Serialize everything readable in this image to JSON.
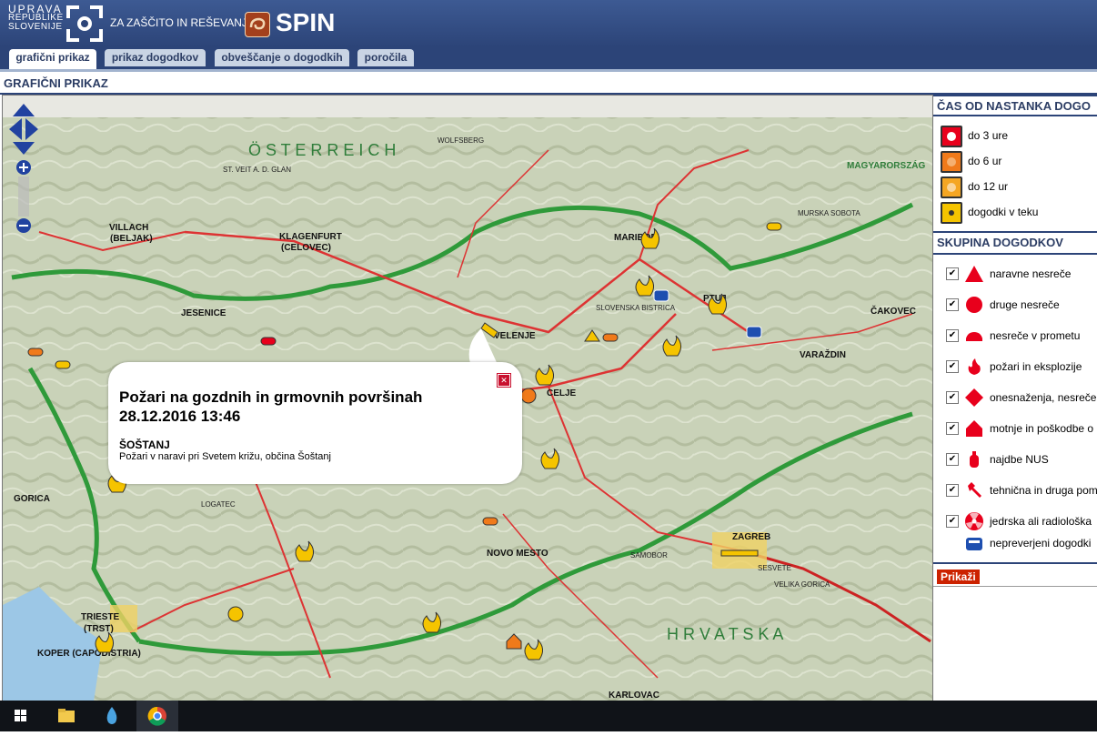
{
  "header": {
    "org_line1": "UPRAVA",
    "org_line2": "REPUBLIKE",
    "org_line3": "SLOVENIJE",
    "org_subtitle": "ZA ZAŠČITO IN REŠEVANJE",
    "app_name": "SPIN"
  },
  "tabs": [
    {
      "label": "grafični prikaz",
      "active": true
    },
    {
      "label": "prikaz dogodkov",
      "active": false
    },
    {
      "label": "obveščanje o dogodkih",
      "active": false
    },
    {
      "label": "poročila",
      "active": false
    }
  ],
  "page_title": "GRAFIČNI PRIKAZ",
  "popup": {
    "title_line1": "Požari na gozdnih in grmovnih površinah",
    "title_line2": "28.12.2016 13:46",
    "location": "ŠOŠTANJ",
    "description": "Požari v naravi pri Svetem križu, občina Šoštanj"
  },
  "sidebar": {
    "time_heading": "ČAS OD NASTANKA DOGO",
    "time_legend": [
      {
        "label": "do 3 ure",
        "color": "#e8001c"
      },
      {
        "label": "do 6 ur",
        "color": "#f07a1a"
      },
      {
        "label": "do 12 ur",
        "color": "#f5a623"
      },
      {
        "label": "dogodki v teku",
        "color": "#f5c400"
      }
    ],
    "group_heading": "SKUPINA DOGODKOV",
    "groups": [
      {
        "label": "naravne nesreče",
        "icon": "triangle-warning-icon",
        "checked": true
      },
      {
        "label": "druge nesreče",
        "icon": "circle-icon",
        "checked": true
      },
      {
        "label": "nesreče v prometu",
        "icon": "car-icon",
        "checked": true
      },
      {
        "label": "požari in eksplozije",
        "icon": "flame-icon",
        "checked": true
      },
      {
        "label": "onesnaženja, nesreče",
        "icon": "diamond-icon",
        "checked": true
      },
      {
        "label": "motnje in poškodbe o",
        "icon": "house-icon",
        "checked": true
      },
      {
        "label": "najdbe NUS",
        "icon": "bomb-icon",
        "checked": true
      },
      {
        "label": "tehnična in druga pom",
        "icon": "wrench-icon",
        "checked": true
      },
      {
        "label": "jedrska ali radiološka",
        "icon": "radiation-icon",
        "checked": true
      },
      {
        "label": "nepreverjeni dogodki",
        "icon": "phone-icon",
        "checked": false
      }
    ],
    "show_button": "Prikaži"
  },
  "map_labels": {
    "klagenfurt": "KLAGENFURT",
    "celovec": "(CELOVEC)",
    "maribor": "MARIBOR",
    "celje": "CELJE",
    "zagreb": "ZAGREB",
    "trieste": "TRIESTE",
    "trst": "(TRST)",
    "velenje": "VELENJE",
    "villach": "VILLACH",
    "beljak": "(BELJAK)",
    "ptuj": "PTUJ",
    "novo_mesto": "NOVO MESTO",
    "koper": "KOPER (CAPODISTRIA)",
    "murska_sobota": "MURSKA SOBOTA",
    "varazdin": "VARAŽDIN",
    "cakovec": "ČAKOVEC",
    "karlovac": "KARLOVAC",
    "samobor": "SAMOBOR",
    "logatec": "LOGATEC",
    "gorica": "GORICA",
    "slovenska_bistrica": "SLOVENSKA BISTRICA",
    "jesenice": "JESENICE",
    "st_veit": "ST. VEIT A. D. GLAN",
    "wolfsberg": "WOLFSBERG",
    "sesvete": "SESVETE",
    "velika_gorica": "VELIKA GORICA",
    "osterreich": "Ö S T E R R E I C H",
    "hrvatska": "H R V A T S K A",
    "magyarorszag": "MAGYARORSZÁG"
  },
  "taskbar": {
    "items": [
      "windows-start-icon",
      "file-explorer-icon",
      "water-drop-app-icon",
      "chrome-icon"
    ]
  }
}
